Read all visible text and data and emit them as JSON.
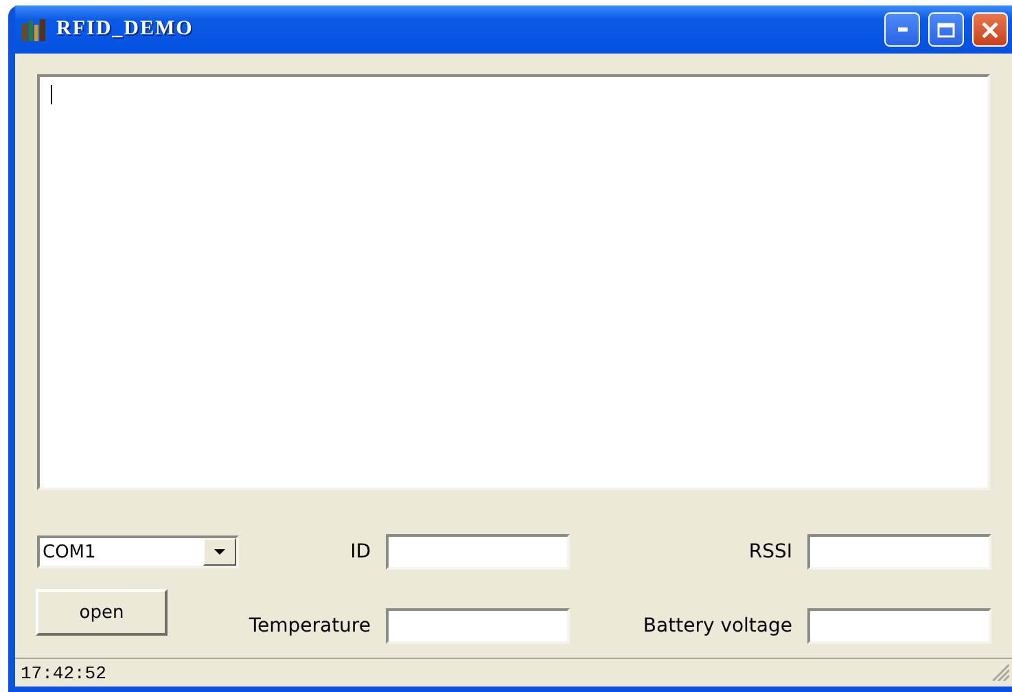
{
  "window": {
    "title": "RFID_DEMO"
  },
  "port_select": {
    "value": "COM1"
  },
  "open_button": {
    "label": "open"
  },
  "fields": [
    {
      "label": "ID"
    },
    {
      "label": "RSSI"
    },
    {
      "label": "Temperature"
    },
    {
      "label": "Battery voltage"
    }
  ],
  "status_bar": {
    "time": "17:42:52"
  }
}
